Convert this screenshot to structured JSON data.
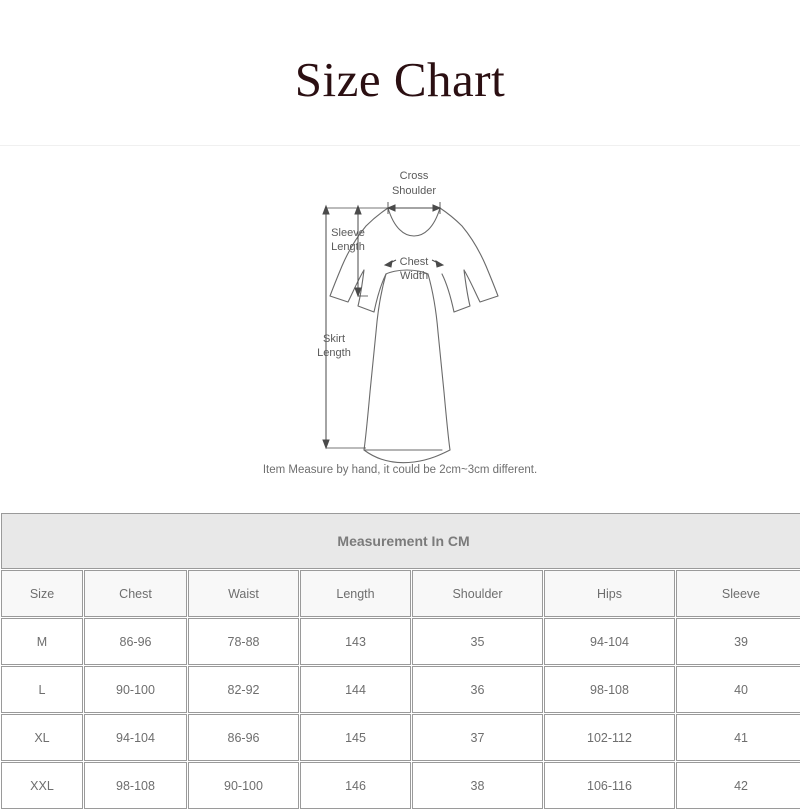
{
  "header": {
    "title": "Size Chart"
  },
  "diagram": {
    "name": "dress-measurement-diagram",
    "labels": {
      "cross_shoulder_line1": "Cross",
      "cross_shoulder_line2": "Shoulder",
      "sleeve_length_line1": "Sleeve",
      "sleeve_length_line2": "Length",
      "chest_width_line1": "Chest",
      "chest_width_line2": "Width",
      "skirt_length_line1": "Skirt",
      "skirt_length_line2": "Length"
    },
    "caption": "Item Measure by hand, it could be 2cm~3cm different."
  },
  "table": {
    "band_label": "Measurement In CM",
    "columns": [
      "Size",
      "Chest",
      "Waist",
      "Length",
      "Shoulder",
      "Hips",
      "Sleeve"
    ],
    "rows": [
      {
        "size": "M",
        "chest": "86-96",
        "waist": "78-88",
        "length": "143",
        "shoulder": "35",
        "hips": "94-104",
        "sleeve": "39"
      },
      {
        "size": "L",
        "chest": "90-100",
        "waist": "82-92",
        "length": "144",
        "shoulder": "36",
        "hips": "98-108",
        "sleeve": "40"
      },
      {
        "size": "XL",
        "chest": "94-104",
        "waist": "86-96",
        "length": "145",
        "shoulder": "37",
        "hips": "102-112",
        "sleeve": "41"
      },
      {
        "size": "XXL",
        "chest": "98-108",
        "waist": "90-100",
        "length": "146",
        "shoulder": "38",
        "hips": "106-116",
        "sleeve": "42"
      }
    ]
  },
  "colors": {
    "title": "#2b0f12",
    "band_bg": "#e8e8e8",
    "header_bg": "#f8f8f8",
    "cell_border": "#9a9a9a",
    "text": "#6e6e6e",
    "diagram_stroke": "#6a6a6a",
    "divider": "#f0f0f0"
  }
}
